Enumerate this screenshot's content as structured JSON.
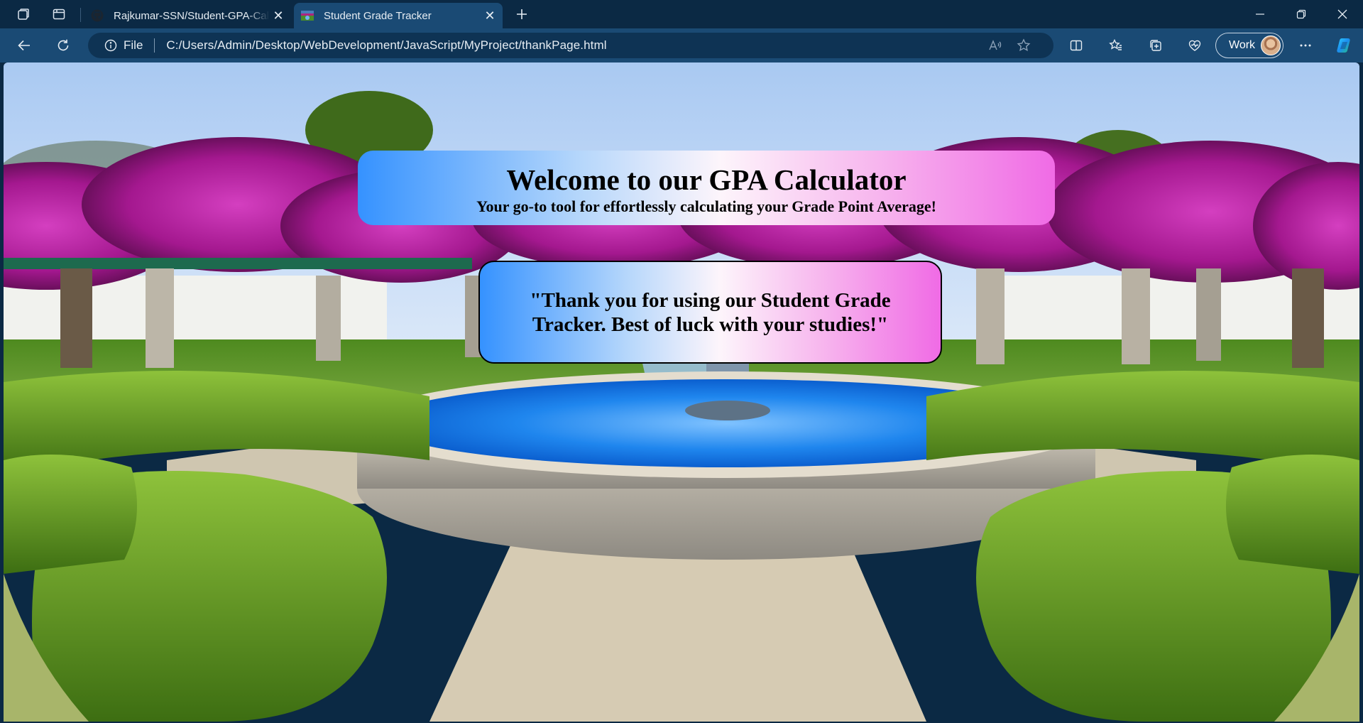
{
  "browser": {
    "tabs": [
      {
        "title": "Rajkumar-SSN/Student-GPA-Calculator",
        "active": false
      },
      {
        "title": "Student Grade Tracker",
        "active": true
      }
    ],
    "address": {
      "scheme_label": "File",
      "url": "C:/Users/Admin/Desktop/WebDevelopment/JavaScript/MyProject/thankPage.html"
    },
    "profile_label": "Work",
    "icons": [
      "workspaces-icon",
      "tab-actions-icon",
      "github-icon",
      "page-favicon",
      "close-tab-icon",
      "new-tab-icon",
      "minimize-icon",
      "restore-icon",
      "close-window-icon",
      "back-icon",
      "refresh-icon",
      "info-icon",
      "read-aloud-icon",
      "favorite-star-icon",
      "split-screen-icon",
      "favorites-icon",
      "collections-icon",
      "browser-essentials-icon",
      "more-icon",
      "copilot-icon"
    ]
  },
  "page": {
    "welcome": {
      "title": "Welcome to our GPA Calculator",
      "subtitle": "Your go-to tool for effortlessly calculating your Grade Point Average!"
    },
    "thanks_message": "\"Thank you for using our Student Grade Tracker. Best of luck with your studies!\"",
    "background_description_colors": {
      "sky": "#bcd6f6",
      "bougainvillea": "#b21c9a",
      "hedge": "#5f9a1d",
      "water": "#1f86ee",
      "stone": "#c9c1b2",
      "path": "#d6cbb3"
    },
    "card_gradient": [
      "#3592ff",
      "#fdf5fb",
      "#f06be5"
    ]
  }
}
